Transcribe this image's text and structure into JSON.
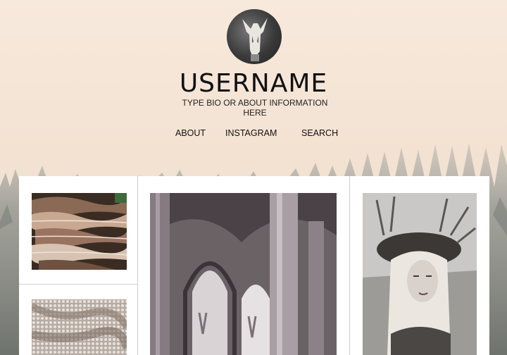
{
  "profile": {
    "username": "USERNAME",
    "bio": "TYPE BIO OR ABOUT INFORMATION HERE",
    "avatar_icon": "skull-icon"
  },
  "nav": [
    {
      "label": "ABOUT"
    },
    {
      "label": "INSTAGRAM"
    },
    {
      "label": "SEARCH"
    }
  ],
  "posts": [
    {
      "subject": "mushrooms"
    },
    {
      "subject": "sequin-fabric"
    },
    {
      "subject": "cathedral-arches"
    },
    {
      "subject": "antler-crown-portrait"
    }
  ],
  "colors": {
    "background_top": "#f7e9dc",
    "forest": "#8c8f8a",
    "card": "#ffffff",
    "divider": "#cfcfcf",
    "text": "#111111"
  }
}
